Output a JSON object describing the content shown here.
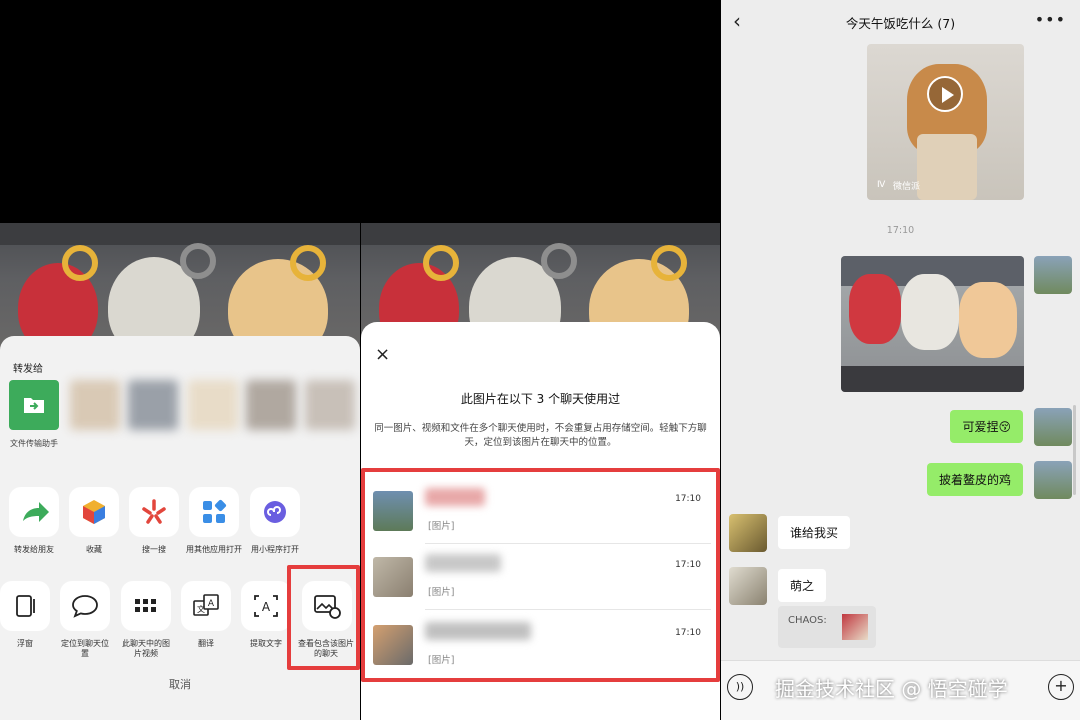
{
  "share_sheet": {
    "title": "转发给",
    "file_helper_label": "文件传输助手",
    "actions_row1": [
      {
        "label": "转发给朋友",
        "icon": "forward-arrow-icon"
      },
      {
        "label": "收藏",
        "icon": "cube-icon"
      },
      {
        "label": "搜一搜",
        "icon": "search-spark-icon"
      },
      {
        "label": "用其他应用打开",
        "icon": "grid-apps-icon"
      },
      {
        "label": "用小程序打开",
        "icon": "miniprogram-icon"
      }
    ],
    "actions_row2": [
      {
        "label": "浮窗",
        "icon": "float-window-icon"
      },
      {
        "label": "定位到聊天位置",
        "icon": "chat-bubble-icon"
      },
      {
        "label": "此聊天中的图片视频",
        "icon": "grid-dots-icon"
      },
      {
        "label": "翻译",
        "icon": "translate-icon"
      },
      {
        "label": "提取文字",
        "icon": "text-extract-icon"
      },
      {
        "label": "查看包含该图片的聊天",
        "icon": "image-chat-icon"
      }
    ],
    "cancel_label": "取消"
  },
  "usage_modal": {
    "close_icon": "×",
    "title": "此图片在以下 3 个聊天使用过",
    "description": "同一图片、视频和文件在多个聊天使用时，不会重复占用存储空间。轻触下方聊天，定位到该图片在聊天中的位置。",
    "chats": [
      {
        "time": "17:10",
        "subtitle": "[图片]"
      },
      {
        "time": "17:10",
        "subtitle": "[图片]"
      },
      {
        "time": "17:10",
        "subtitle": "[图片]"
      }
    ]
  },
  "chat": {
    "title": "今天午饭吃什么 (7)",
    "back_icon": "‹",
    "more_icon": "•••",
    "video_source": "微信派",
    "timestamp": "17:10",
    "messages": [
      {
        "side": "right",
        "text": "可爱捏😚"
      },
      {
        "side": "right",
        "text": "披着鳌皮的鸡"
      },
      {
        "side": "left",
        "text": "谁给我买"
      },
      {
        "side": "left",
        "text": "萌之"
      }
    ],
    "quote_label": "CHAOS:",
    "watermark": "掘金技术社区 @ 悟空碰学"
  },
  "colors": {
    "highlight": "#e53d3d",
    "bubble_green": "#95ec69",
    "file_helper": "#3dab5b"
  }
}
